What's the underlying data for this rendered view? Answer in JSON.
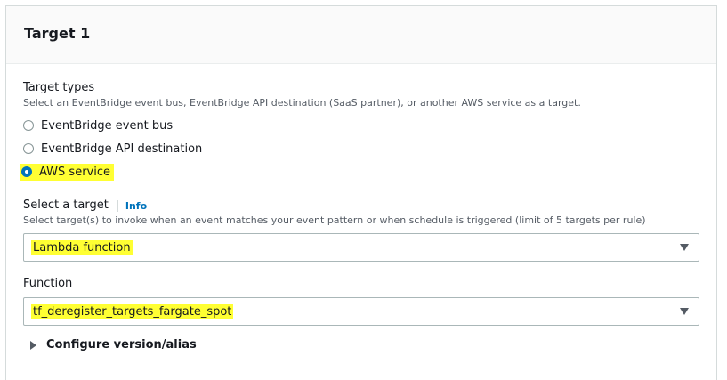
{
  "panel": {
    "title": "Target 1"
  },
  "target_types": {
    "label": "Target types",
    "description": "Select an EventBridge event bus, EventBridge API destination (SaaS partner), or another AWS service as a target.",
    "options": [
      {
        "label": "EventBridge event bus",
        "selected": false
      },
      {
        "label": "EventBridge API destination",
        "selected": false
      },
      {
        "label": "AWS service",
        "selected": true
      }
    ]
  },
  "select_target": {
    "label": "Select a target",
    "info_link": "Info",
    "description": "Select target(s) to invoke when an event matches your event pattern or when schedule is triggered (limit of 5 targets per rule)",
    "value": "Lambda function"
  },
  "function": {
    "label": "Function",
    "value": "tf_deregister_targets_fargate_spot"
  },
  "configure_version": {
    "label": "Configure version/alias"
  },
  "colors": {
    "highlight": "#ffff33",
    "accent": "#0073bb",
    "border": "#aab7b8"
  }
}
